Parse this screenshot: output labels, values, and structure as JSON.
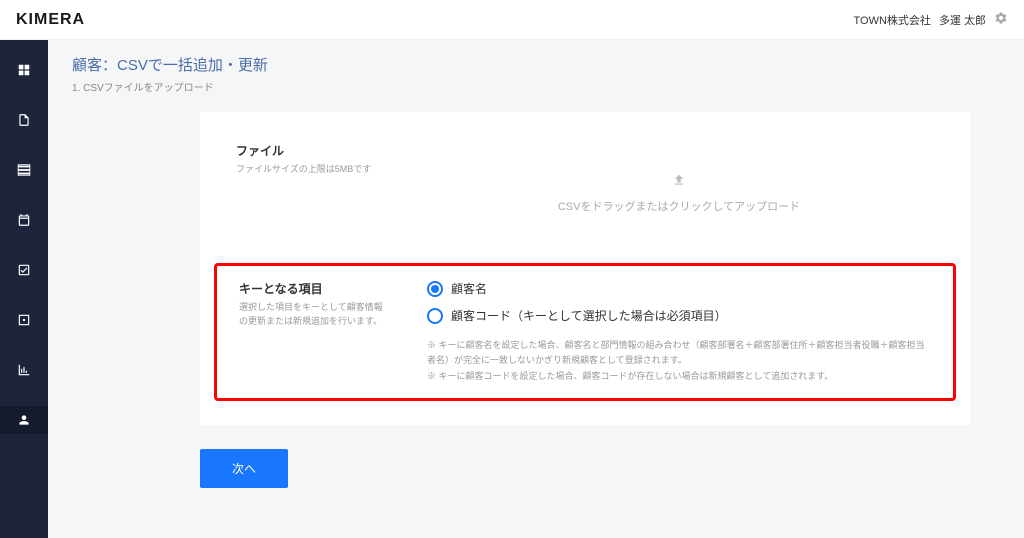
{
  "topbar": {
    "logo": "KIMERA",
    "company": "TOWN株式会社",
    "user": "多運 太郎"
  },
  "sidebar": {
    "items": [
      {
        "icon": "dashboard"
      },
      {
        "icon": "document"
      },
      {
        "icon": "list"
      },
      {
        "icon": "calendar"
      },
      {
        "icon": "check"
      },
      {
        "icon": "box"
      },
      {
        "icon": "chart"
      },
      {
        "icon": "person"
      }
    ]
  },
  "page": {
    "title": "顧客：CSVで一括追加・更新",
    "subtitle": "1. CSVファイルをアップロード"
  },
  "form": {
    "file": {
      "label": "ファイル",
      "help": "ファイルサイズの上限は5MBです",
      "upload_text": "CSVをドラッグまたはクリックしてアップロード"
    },
    "key_field": {
      "label": "キーとなる項目",
      "help": "選択した項目をキーとして顧客情報の更新または新規追加を行います。",
      "options": {
        "name": "顧客名",
        "code": "顧客コード（キーとして選択した場合は必須項目）"
      },
      "note1": "※ キーに顧客名を設定した場合、顧客名と部門情報の組み合わせ（顧客部署名＋顧客部署住所＋顧客担当者役職＋顧客担当者名）が完全に一致しないかぎり新規顧客として登録されます。",
      "note2": "※ キーに顧客コードを設定した場合、顧客コードが存在しない場合は新規顧客として追加されます。"
    }
  },
  "buttons": {
    "next": "次へ"
  }
}
